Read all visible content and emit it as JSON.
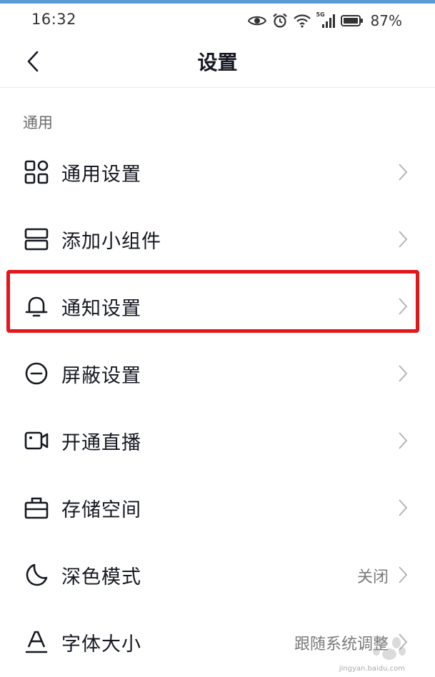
{
  "status_bar": {
    "time": "16:32",
    "network": "5G",
    "battery": "87%"
  },
  "header": {
    "title": "设置"
  },
  "section": {
    "title": "通用"
  },
  "items": [
    {
      "label": "通用设置",
      "value": "",
      "icon": "grid-icon"
    },
    {
      "label": "添加小组件",
      "value": "",
      "icon": "widget-icon"
    },
    {
      "label": "通知设置",
      "value": "",
      "icon": "bell-icon"
    },
    {
      "label": "屏蔽设置",
      "value": "",
      "icon": "block-icon"
    },
    {
      "label": "开通直播",
      "value": "",
      "icon": "video-camera-icon"
    },
    {
      "label": "存储空间",
      "value": "",
      "icon": "storage-icon"
    },
    {
      "label": "深色模式",
      "value": "关闭",
      "icon": "moon-icon"
    },
    {
      "label": "字体大小",
      "value": "跟随系统调整",
      "icon": "font-size-icon"
    }
  ],
  "watermark": {
    "text": "jingyan.baidu.com"
  },
  "colors": {
    "highlight": "#e5161b",
    "top_strip": "#5b9bd5",
    "text_primary": "#161823",
    "text_secondary": "#7a7a7a"
  }
}
